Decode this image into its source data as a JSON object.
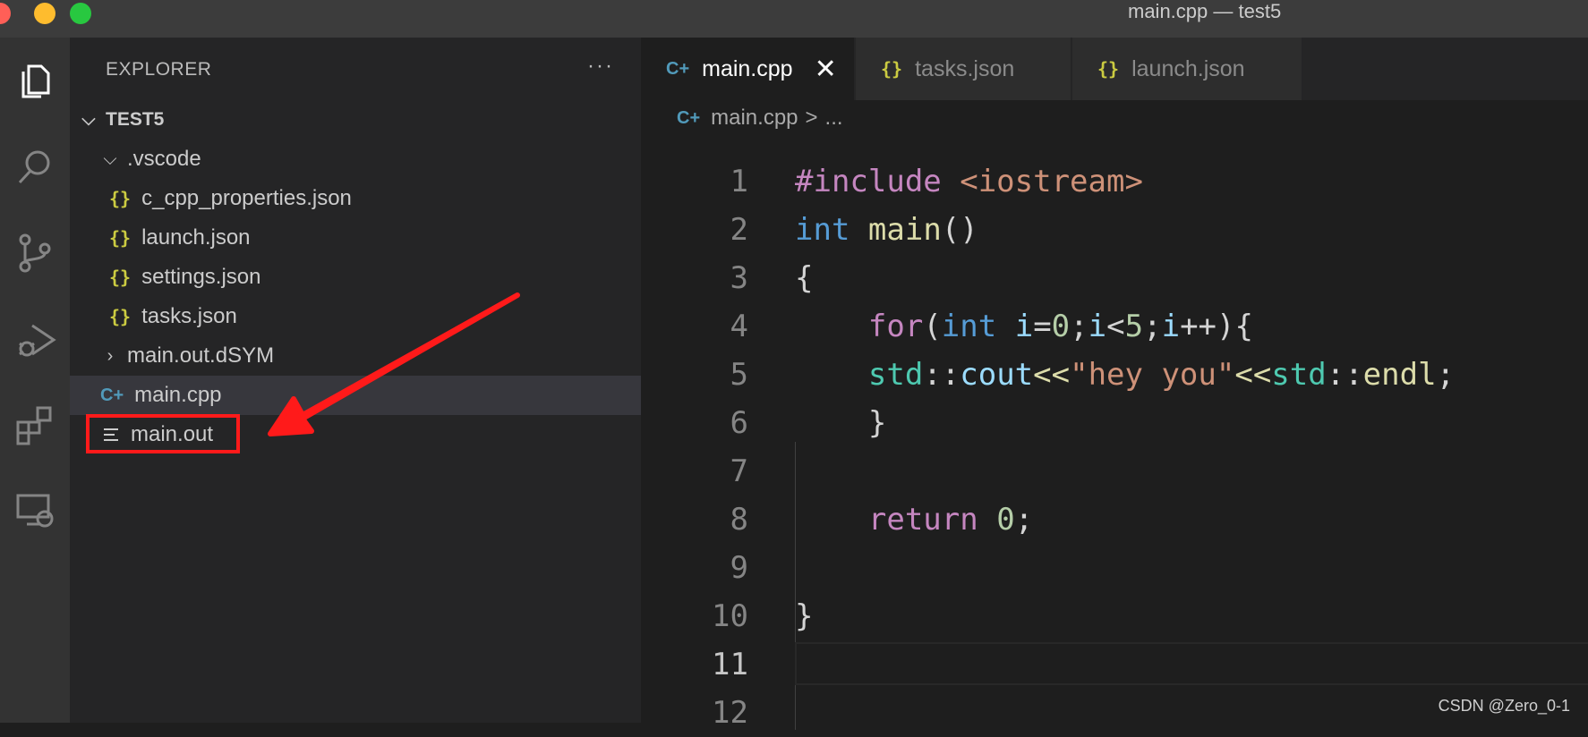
{
  "window": {
    "title": "main.cpp — test5"
  },
  "activity_bar": [
    "files-icon",
    "search-icon",
    "source-control-icon",
    "run-debug-icon",
    "extensions-icon",
    "remote-explorer-icon"
  ],
  "sidebar": {
    "header": "EXPLORER",
    "more": "···",
    "root": "TEST5",
    "tree": [
      {
        "label": ".vscode",
        "kind": "folder-open"
      },
      {
        "label": "c_cpp_properties.json",
        "kind": "json"
      },
      {
        "label": "launch.json",
        "kind": "json"
      },
      {
        "label": "settings.json",
        "kind": "json"
      },
      {
        "label": "tasks.json",
        "kind": "json"
      },
      {
        "label": "main.out.dSYM",
        "kind": "folder-closed"
      },
      {
        "label": "main.cpp",
        "kind": "cpp",
        "selected": true
      },
      {
        "label": "main.out",
        "kind": "binary",
        "highlighted": true
      }
    ],
    "json_glyph": "{}",
    "cpp_glyph": "C+"
  },
  "editor": {
    "tabs": [
      {
        "label": "main.cpp",
        "active": true,
        "close": "✕"
      },
      {
        "label": "tasks.json",
        "active": false
      },
      {
        "label": "launch.json",
        "active": false
      }
    ],
    "breadcrumb": {
      "file": "main.cpp",
      "sep": ">",
      "rest": "..."
    },
    "line_numbers": [
      "1",
      "2",
      "3",
      "4",
      "5",
      "6",
      "7",
      "8",
      "9",
      "10",
      "11",
      "12"
    ],
    "current_line": "11",
    "code": {
      "l1": {
        "a": "#include ",
        "b": "<iostream>"
      },
      "l2": {
        "a": "int",
        "b": " ",
        "c": "main",
        "d": "()"
      },
      "l3": "{",
      "l4": {
        "indent": "    ",
        "kw": "for",
        "p1": "(",
        "type": "int",
        "sp": " ",
        "v1": "i",
        "eq": "=",
        "n0": "0",
        "semi1": ";",
        "v2": "i",
        "lt": "<",
        "n5": "5",
        "semi2": ";",
        "v3": "i",
        "inc": "++){"
      },
      "l5": {
        "indent": "    ",
        "ns1": "std",
        "sep1": "::",
        "cout": "cout",
        "op1": "<<",
        "str": "\"hey you\"",
        "op2": "<<",
        "ns2": "std",
        "sep2": "::",
        "endl": "endl",
        "semi": ";"
      },
      "l6": "    }",
      "l7": "",
      "l8": {
        "indent": "    ",
        "ret": "return",
        "sp": " ",
        "num": "0",
        "semi": ";"
      },
      "l9": "",
      "l10": "}",
      "l11": "",
      "l12": ""
    }
  },
  "watermark": "CSDN @Zero_0-1",
  "colors": {
    "annotation": "#ff1a1a",
    "json_icon": "#cbcb41",
    "cpp_icon": "#519aba"
  }
}
